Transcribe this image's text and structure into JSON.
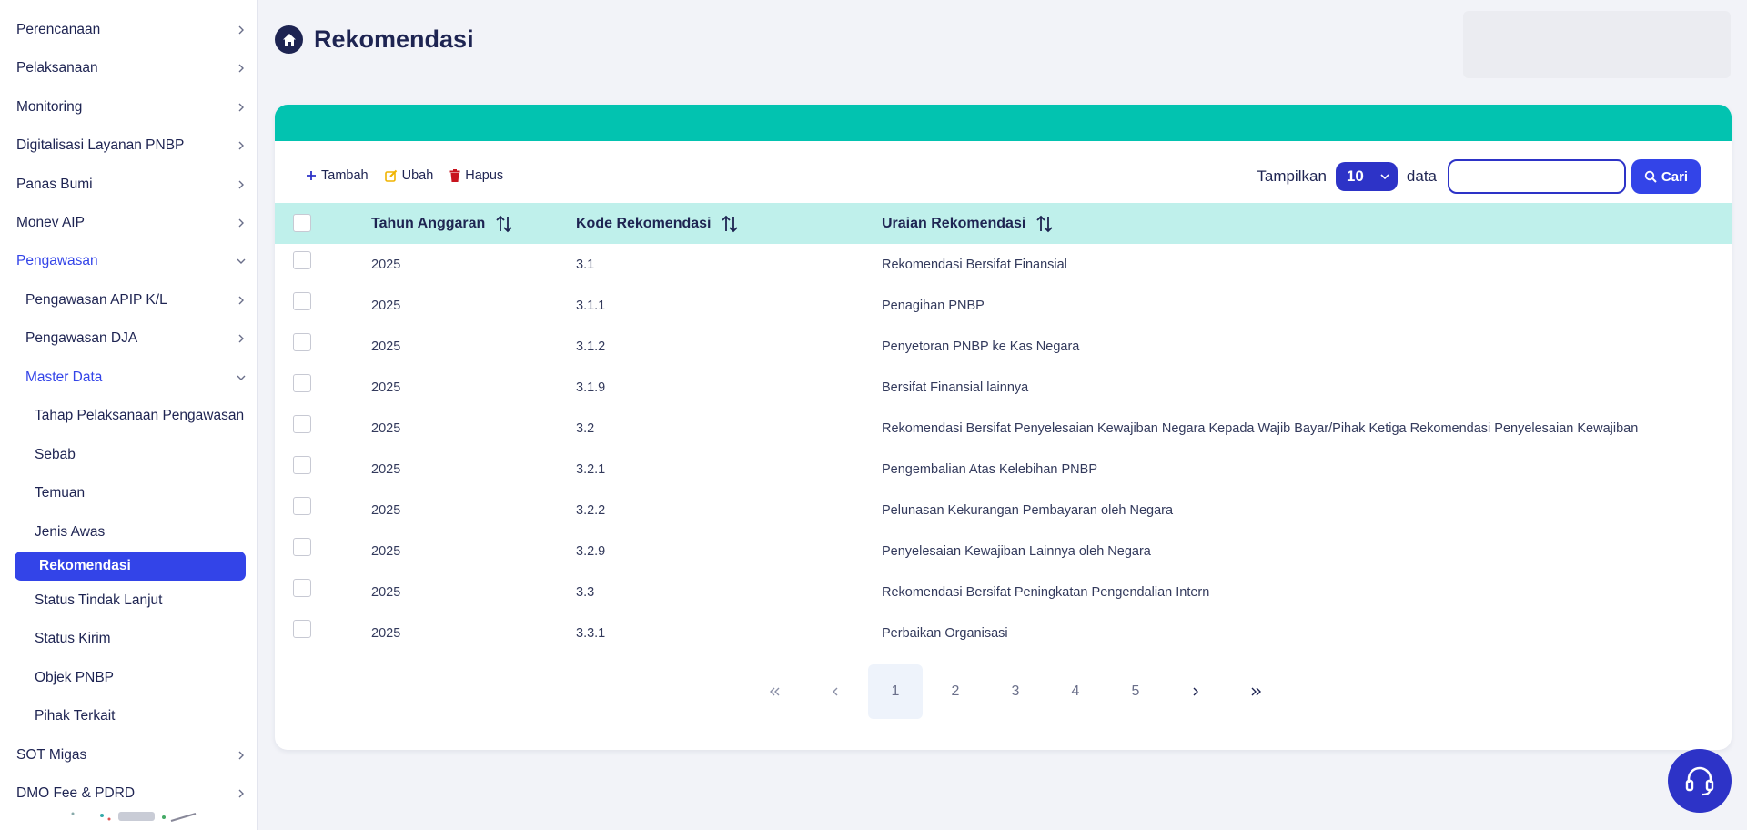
{
  "sidebar": {
    "items": [
      {
        "label": "Perencanaan"
      },
      {
        "label": "Pelaksanaan"
      },
      {
        "label": "Monitoring"
      },
      {
        "label": "Digitalisasi Layanan PNBP"
      },
      {
        "label": "Panas Bumi"
      },
      {
        "label": "Monev AIP"
      },
      {
        "label": "Pengawasan"
      },
      {
        "label": "Pengawasan APIP K/L"
      },
      {
        "label": "Pengawasan DJA"
      },
      {
        "label": "Master Data"
      },
      {
        "label": "Tahap Pelaksanaan Pengawasan"
      },
      {
        "label": "Sebab"
      },
      {
        "label": "Temuan"
      },
      {
        "label": "Jenis Awas"
      },
      {
        "label": "Rekomendasi"
      },
      {
        "label": "Status Tindak Lanjut"
      },
      {
        "label": "Status Kirim"
      },
      {
        "label": "Objek PNBP"
      },
      {
        "label": "Pihak Terkait"
      },
      {
        "label": "SOT Migas"
      },
      {
        "label": "DMO Fee & PDRD"
      }
    ]
  },
  "header": {
    "title": "Rekomendasi"
  },
  "toolbar": {
    "add_label": "Tambah",
    "edit_label": "Ubah",
    "delete_label": "Hapus"
  },
  "filter": {
    "show_label": "Tampilkan",
    "page_size": "10",
    "data_label": "data",
    "search_placeholder": "",
    "search_button": "Cari"
  },
  "table": {
    "columns": [
      "Tahun Anggaran",
      "Kode Rekomendasi",
      "Uraian Rekomendasi"
    ],
    "rows": [
      [
        "2025",
        "3.1",
        "Rekomendasi Bersifat Finansial"
      ],
      [
        "2025",
        "3.1.1",
        "Penagihan PNBP"
      ],
      [
        "2025",
        "3.1.2",
        "Penyetoran PNBP ke Kas Negara"
      ],
      [
        "2025",
        "3.1.9",
        "Bersifat Finansial lainnya"
      ],
      [
        "2025",
        "3.2",
        "Rekomendasi Bersifat Penyelesaian Kewajiban Negara Kepada Wajib Bayar/Pihak Ketiga Rekomendasi Penyelesaian Kewajiban"
      ],
      [
        "2025",
        "3.2.1",
        "Pengembalian Atas Kelebihan PNBP"
      ],
      [
        "2025",
        "3.2.2",
        "Pelunasan Kekurangan Pembayaran oleh Negara"
      ],
      [
        "2025",
        "3.2.9",
        "Penyelesaian Kewajiban Lainnya oleh Negara"
      ],
      [
        "2025",
        "3.3",
        "Rekomendasi Bersifat Peningkatan Pengendalian Intern"
      ],
      [
        "2025",
        "3.3.1",
        "Perbaikan Organisasi"
      ]
    ]
  },
  "pagination": {
    "pages": [
      "1",
      "2",
      "3",
      "4",
      "5"
    ],
    "current": "1"
  },
  "colors": {
    "primary": "#3344e8",
    "navy": "#1e2452",
    "teal": "#02c3b0",
    "header_row": "#bff0eb"
  }
}
